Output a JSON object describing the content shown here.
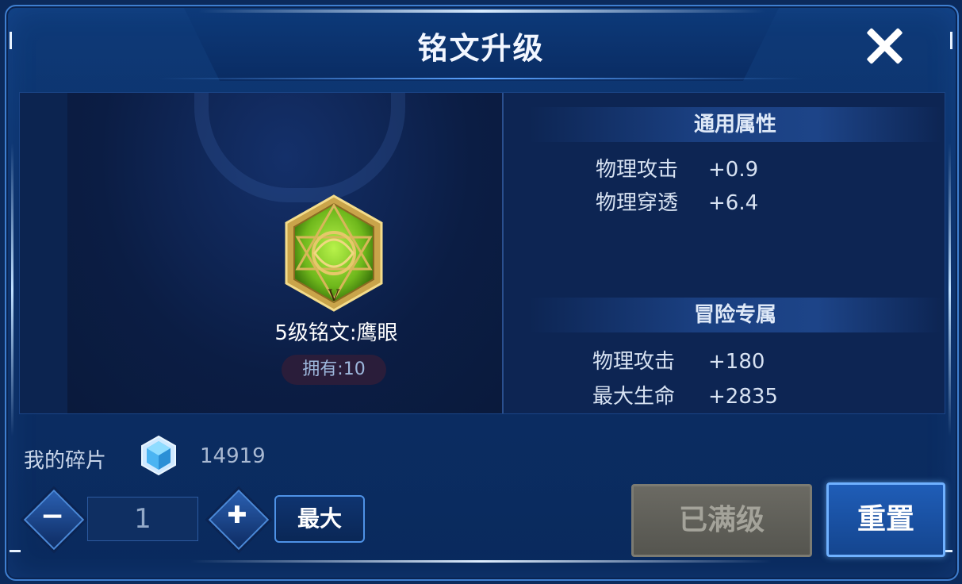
{
  "window": {
    "title": "铭文升级",
    "close_icon": "close-icon"
  },
  "rune": {
    "name": "5级铭文:鹰眼",
    "owned_label": "拥有:10",
    "level_numeral": "V",
    "icon": "rune-hexagon-icon",
    "accent_color": "#7ecb2a",
    "frame_color": "#c9a44a"
  },
  "general": {
    "heading": "通用属性",
    "stats": [
      {
        "name": "物理攻击",
        "value": "+0.9"
      },
      {
        "name": "物理穿透",
        "value": "+6.4"
      }
    ]
  },
  "adventure": {
    "heading": "冒险专属",
    "stats": [
      {
        "name": "物理攻击",
        "value": "+180"
      },
      {
        "name": "最大生命",
        "value": "+2835"
      }
    ]
  },
  "shards": {
    "label": "我的碎片",
    "count": "14919",
    "icon": "crystal-shard-icon"
  },
  "quantity": {
    "value": "1",
    "minus": "−",
    "plus": "✚",
    "max_label": "最大"
  },
  "actions": {
    "maxed_label": "已满级",
    "reset_label": "重置"
  },
  "colors": {
    "panel_bg": "#0b2a5c",
    "button_blue": "#1f5db7",
    "disabled_gray": "#6b6a63"
  }
}
